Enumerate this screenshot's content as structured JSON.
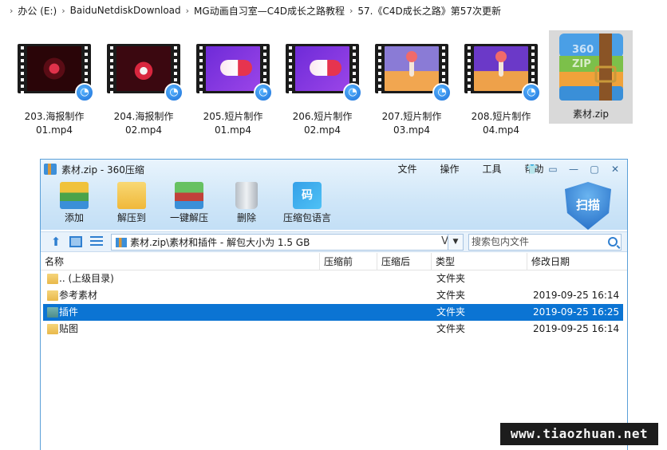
{
  "explorer": {
    "breadcrumb": [
      "办公 (E:)",
      "BaiduNetdiskDownload",
      "MG动画自习室—C4D成长之路教程",
      "57.《C4D成长之路》第57次更新"
    ],
    "files": [
      {
        "name_line1": "203.海报制作",
        "name_line2": "01.mp4"
      },
      {
        "name_line1": "204.海报制作",
        "name_line2": "02.mp4"
      },
      {
        "name_line1": "205.短片制作",
        "name_line2": "01.mp4"
      },
      {
        "name_line1": "206.短片制作",
        "name_line2": "02.mp4"
      },
      {
        "name_line1": "207.短片制作",
        "name_line2": "03.mp4"
      },
      {
        "name_line1": "208.短片制作",
        "name_line2": "04.mp4"
      }
    ],
    "zip_file": {
      "name": "素材.zip",
      "icon_text": "360\nZIP"
    }
  },
  "zip_window": {
    "title": "素材.zip - 360压缩",
    "menu": [
      "文件",
      "操作",
      "工具",
      "帮助"
    ],
    "toolbar": [
      "添加",
      "解压到",
      "一键解压",
      "删除",
      "压缩包语言"
    ],
    "lang_icon_text": "码",
    "scan_label": "扫描",
    "path": "素材.zip\\素材和插件 - 解包大小为 1.5 GB",
    "path_v": "V",
    "search_placeholder": "搜索包内文件",
    "columns": [
      "名称",
      "压缩前",
      "压缩后",
      "类型",
      "修改日期"
    ],
    "rows": [
      {
        "name": ".. (上级目录)",
        "before": "",
        "after": "",
        "type": "文件夹",
        "date": ""
      },
      {
        "name": "参考素材",
        "before": "",
        "after": "",
        "type": "文件夹",
        "date": "2019-09-25 16:14"
      },
      {
        "name": "插件",
        "before": "",
        "after": "",
        "type": "文件夹",
        "date": "2019-09-25 16:25",
        "selected": true
      },
      {
        "name": "贴图",
        "before": "",
        "after": "",
        "type": "文件夹",
        "date": "2019-09-25 16:14"
      }
    ]
  },
  "watermark": "www.tiaozhuan.net"
}
